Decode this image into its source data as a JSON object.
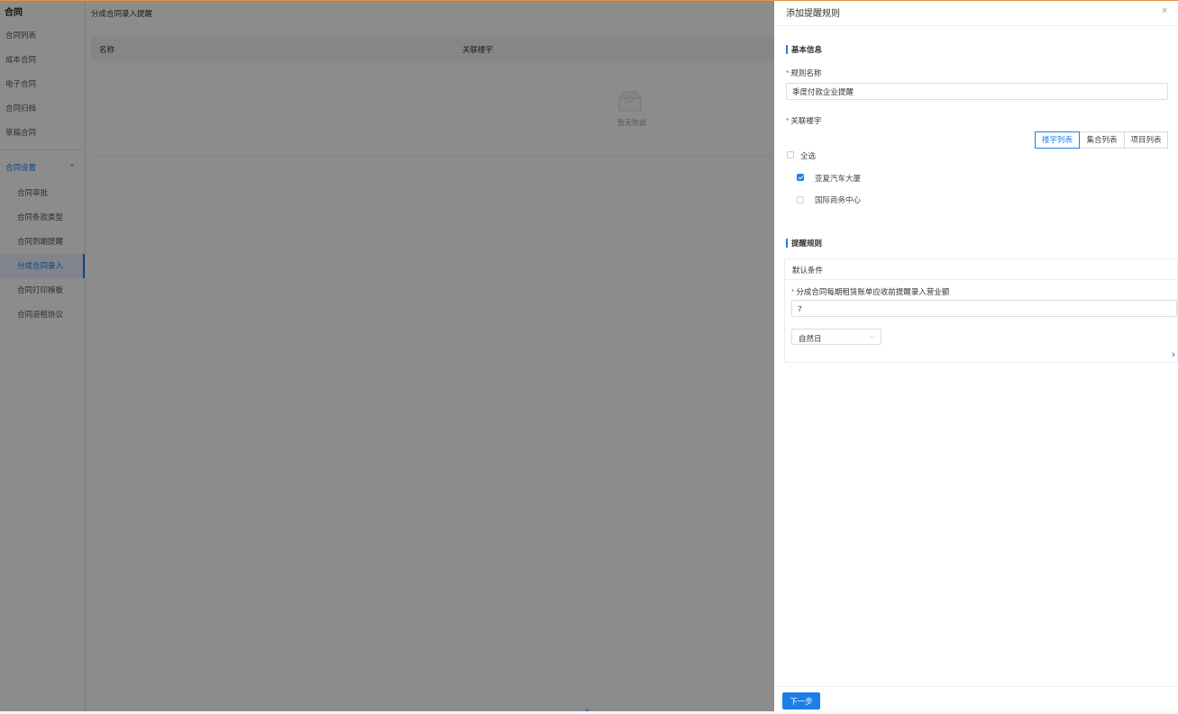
{
  "sidebar": {
    "title": "合同",
    "items": [
      "合同列表",
      "成本合同",
      "电子合同",
      "合同归档",
      "草稿合同"
    ],
    "group": {
      "label": "合同设置",
      "chevron": "^"
    },
    "sub_items": [
      "合同审批",
      "合同条款类型",
      "合同到期提醒",
      "分成合同录入",
      "合同打印模板",
      "合同退租协议"
    ],
    "active_sub": "分成合同录入"
  },
  "main": {
    "breadcrumb": "分成合同录入提醒",
    "columns": [
      "名称",
      "关联楼宇"
    ],
    "empty_text": "暂无数据"
  },
  "drawer": {
    "title": "添加提醒规则",
    "close": "×",
    "basic_section": "基本信息",
    "rule_name_label": "规则名称",
    "rule_name_value": "季度付款企业提醒",
    "building_label": "关联楼宇",
    "tabs": [
      "楼宇列表",
      "集合列表",
      "项目列表"
    ],
    "active_tab": 0,
    "select_all": "全选",
    "buildings": [
      {
        "name": "亚夏汽车大厦",
        "checked": true
      },
      {
        "name": "国际商务中心",
        "checked": false
      }
    ],
    "rule_section": "提醒规则",
    "default_condition": "默认条件",
    "condition_label": "分成合同每期租赁账单应收前提醒录入营业额",
    "condition_value": "7",
    "day_type": "自然日",
    "next_button": "下一步"
  },
  "colors": {
    "accent": "#1e7ee8",
    "required": "#f04d4d",
    "overlay": "rgba(0,0,0,0.45)"
  }
}
